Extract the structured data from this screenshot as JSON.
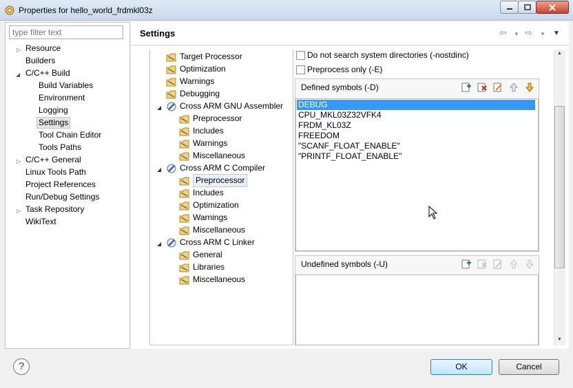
{
  "window": {
    "title": "Properties for hello_world_frdmkl03z"
  },
  "filter": {
    "placeholder": "type filter text"
  },
  "nav": {
    "items": [
      {
        "label": "Resource",
        "has_arrow": true
      },
      {
        "label": "Builders"
      },
      {
        "label": "C/C++ Build",
        "expanded": true
      },
      {
        "label": "Build Variables"
      },
      {
        "label": "Environment"
      },
      {
        "label": "Logging"
      },
      {
        "label": "Settings",
        "selected": true
      },
      {
        "label": "Tool Chain Editor"
      },
      {
        "label": "Tools Paths"
      },
      {
        "label": "C/C++ General",
        "has_arrow": true
      },
      {
        "label": "Linux Tools Path"
      },
      {
        "label": "Project References"
      },
      {
        "label": "Run/Debug Settings"
      },
      {
        "label": "Task Repository",
        "has_arrow": true
      },
      {
        "label": "WikiText"
      }
    ]
  },
  "header": {
    "title": "Settings"
  },
  "tree": {
    "items": [
      {
        "label": "Target Processor"
      },
      {
        "label": "Optimization"
      },
      {
        "label": "Warnings"
      },
      {
        "label": "Debugging"
      },
      {
        "label": "Cross ARM GNU Assembler"
      },
      {
        "label": "Preprocessor"
      },
      {
        "label": "Includes"
      },
      {
        "label": "Warnings"
      },
      {
        "label": "Miscellaneous"
      },
      {
        "label": "Cross ARM C Compiler"
      },
      {
        "label": "Preprocessor",
        "selected": true
      },
      {
        "label": "Includes"
      },
      {
        "label": "Optimization"
      },
      {
        "label": "Warnings"
      },
      {
        "label": "Miscellaneous"
      },
      {
        "label": "Cross ARM C Linker"
      },
      {
        "label": "General"
      },
      {
        "label": "Libraries"
      },
      {
        "label": "Miscellaneous"
      }
    ]
  },
  "options": {
    "nostdinc": "Do not search system directories (-nostdinc)",
    "preprocess_only": "Preprocess only (-E)"
  },
  "defined": {
    "title": "Defined symbols (-D)",
    "symbols": [
      "DEBUG",
      "CPU_MKL03Z32VFK4",
      "FRDM_KL03Z",
      "FREEDOM",
      "\"SCANF_FLOAT_ENABLE\"",
      "\"PRINTF_FLOAT_ENABLE\""
    ]
  },
  "undefined": {
    "title": "Undefined symbols (-U)",
    "symbols": []
  },
  "footer": {
    "ok": "OK",
    "cancel": "Cancel",
    "help": "?"
  },
  "colors": {
    "selection": "#3399ff",
    "accent": "#3c7fb1"
  }
}
